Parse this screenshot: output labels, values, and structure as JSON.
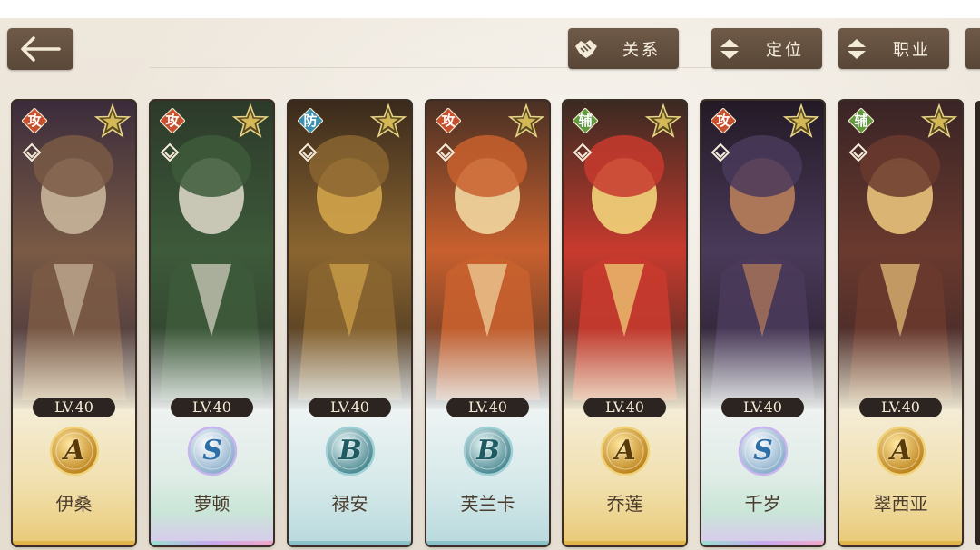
{
  "header": {
    "buttons": [
      {
        "label": "关系",
        "icon": "handshake-icon"
      },
      {
        "label": "定位",
        "icon": "sort-arrows-icon"
      },
      {
        "label": "职业",
        "icon": "sort-arrows-icon"
      }
    ]
  },
  "characters": [
    {
      "name": "伊桑",
      "role": "攻",
      "level": "LV.40",
      "rank": "A",
      "role_color": "#c8502e",
      "portrait_colors": [
        "#7a5a45",
        "#c8b59a",
        "#3b2c3c"
      ]
    },
    {
      "name": "萝顿",
      "role": "攻",
      "level": "LV.40",
      "rank": "S",
      "role_color": "#c8502e",
      "portrait_colors": [
        "#3d5a3a",
        "#d8d4c4",
        "#2c3a2a"
      ]
    },
    {
      "name": "禄安",
      "role": "防",
      "level": "LV.40",
      "rank": "B",
      "role_color": "#3a8fb0",
      "portrait_colors": [
        "#8a6530",
        "#d2a44a",
        "#3a2a1c"
      ]
    },
    {
      "name": "芙兰卡",
      "role": "攻",
      "level": "LV.40",
      "rank": "B",
      "role_color": "#c8502e",
      "portrait_colors": [
        "#c8602e",
        "#f1d6a0",
        "#4a3024"
      ]
    },
    {
      "name": "乔莲",
      "role": "辅",
      "level": "LV.40",
      "rank": "A",
      "role_color": "#5f9a3e",
      "portrait_colors": [
        "#c83a2e",
        "#f2d47a",
        "#3a2a22"
      ]
    },
    {
      "name": "千岁",
      "role": "攻",
      "level": "LV.40",
      "rank": "S",
      "role_color": "#c8502e",
      "portrait_colors": [
        "#4a3a5a",
        "#b87e5a",
        "#231a26"
      ]
    },
    {
      "name": "翠西亚",
      "role": "辅",
      "level": "LV.40",
      "rank": "A",
      "role_color": "#5f9a3e",
      "portrait_colors": [
        "#6a3a2e",
        "#e8c27a",
        "#3a2426"
      ]
    }
  ],
  "colors": {
    "button_bg": "#62503f",
    "rank_A": "#e2a92c",
    "rank_S": "#6ec6d6",
    "rank_B": "#3f8f99"
  }
}
